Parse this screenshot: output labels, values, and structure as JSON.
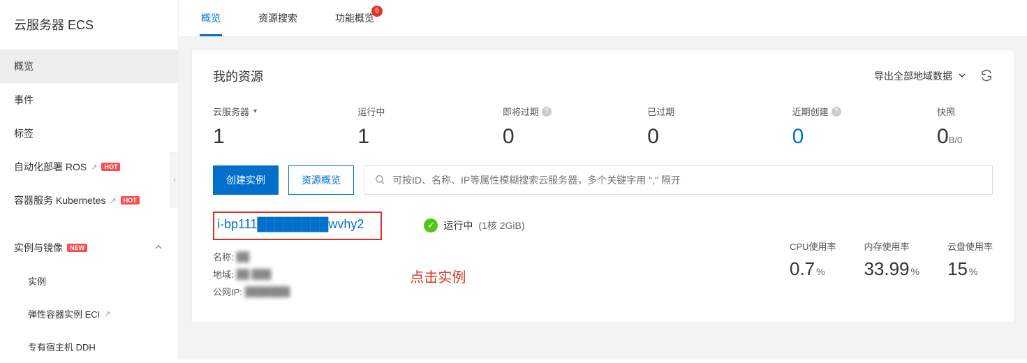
{
  "sidebar": {
    "title": "云服务器 ECS",
    "items": [
      {
        "label": "概览",
        "active": true
      },
      {
        "label": "事件"
      },
      {
        "label": "标签"
      },
      {
        "label": "自动化部署 ROS",
        "external": true,
        "badge": "HOT"
      },
      {
        "label": "容器服务 Kubernetes",
        "external": true,
        "badge": "HOT"
      }
    ],
    "group": {
      "header": "实例与镜像",
      "badge": "NEW",
      "children": [
        {
          "label": "实例"
        },
        {
          "label": "弹性容器实例 ECI",
          "external": true
        },
        {
          "label": "专有宿主机 DDH"
        }
      ]
    }
  },
  "tabs": [
    {
      "label": "概览",
      "active": true
    },
    {
      "label": "资源搜索"
    },
    {
      "label": "功能概览",
      "badge": "6"
    }
  ],
  "panel": {
    "title": "我的资源",
    "export_label": "导出全部地域数据",
    "stats": [
      {
        "label": "云服务器",
        "value": "1"
      },
      {
        "label": "运行中",
        "value": "1"
      },
      {
        "label": "即将过期",
        "value": "0",
        "help": true
      },
      {
        "label": "已过期",
        "value": "0"
      },
      {
        "label": "近期创建",
        "value": "0",
        "help": true,
        "link": true
      },
      {
        "label": "快照",
        "value": "0",
        "unit": "B/0"
      }
    ],
    "buttons": {
      "create": "创建实例",
      "overview": "资源概览"
    },
    "search_placeholder": "可按ID、名称、IP等属性模糊搜索云服务器，多个关键字用 \",\" 隔开",
    "instance": {
      "id": "i-bp111████████wvhy2",
      "name_label": "名称:",
      "name_value": "██",
      "region_label": "地域:",
      "region_value": "██ ███",
      "ip_label": "公网IP:",
      "ip_value": "███████",
      "status": "运行中",
      "spec": "(1核 2GiB)",
      "annotation": "点击实例",
      "metrics": [
        {
          "label": "CPU使用率",
          "value": "0.7",
          "unit": "%"
        },
        {
          "label": "内存使用率",
          "value": "33.99",
          "unit": "%"
        },
        {
          "label": "云盘使用率",
          "value": "15",
          "unit": "%"
        }
      ]
    }
  }
}
